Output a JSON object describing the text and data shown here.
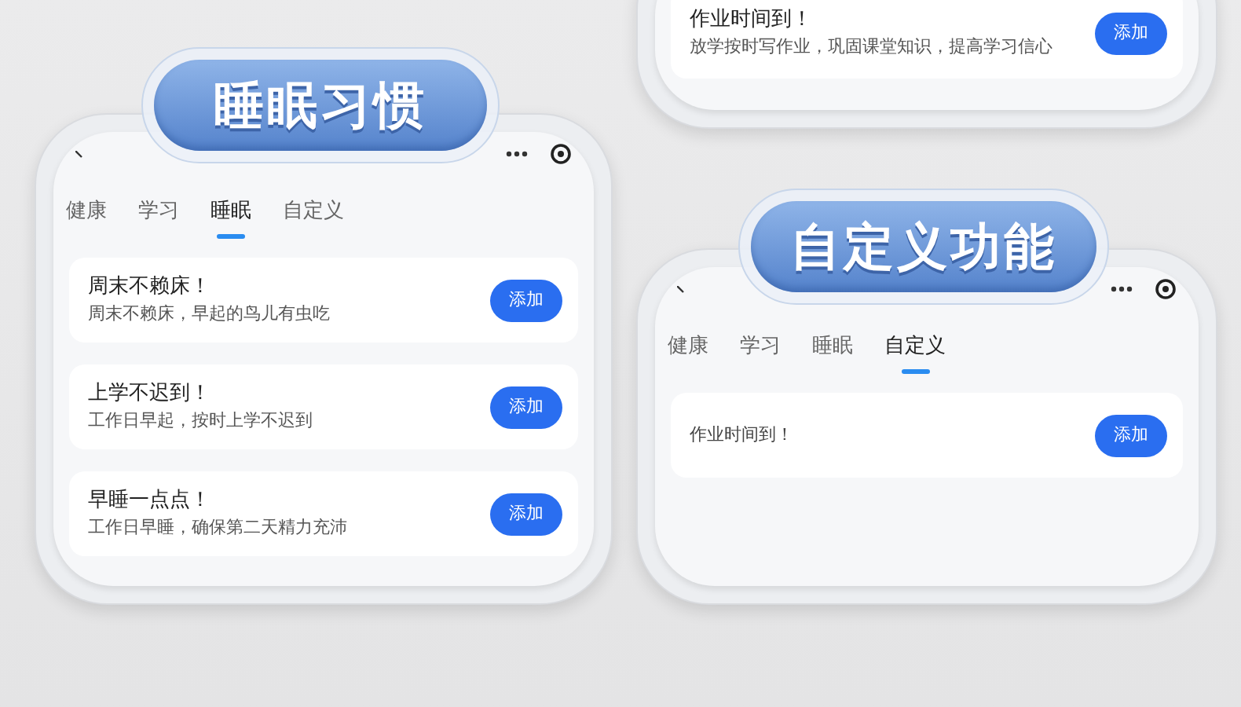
{
  "homework_screen": {
    "cards": [
      {
        "title": "作业时间到！",
        "subtitle": "放学按时写作业，巩固课堂知识，提高学习信心",
        "button": "添加"
      }
    ]
  },
  "sleep_screen": {
    "badge": "睡眠习惯",
    "tabs": [
      {
        "label": "健康",
        "selected": false
      },
      {
        "label": "学习",
        "selected": false
      },
      {
        "label": "睡眠",
        "selected": true
      },
      {
        "label": "自定义",
        "selected": false
      }
    ],
    "cards": [
      {
        "title": "周末不赖床！",
        "subtitle": "周末不赖床，早起的鸟儿有虫吃",
        "button": "添加"
      },
      {
        "title": "上学不迟到！",
        "subtitle": "工作日早起，按时上学不迟到",
        "button": "添加"
      },
      {
        "title": "早睡一点点！",
        "subtitle": "工作日早睡，确保第二天精力充沛",
        "button": "添加"
      }
    ]
  },
  "custom_screen": {
    "badge": "自定义功能",
    "tabs": [
      {
        "label": "健康",
        "selected": false
      },
      {
        "label": "学习",
        "selected": false
      },
      {
        "label": "睡眠",
        "selected": false
      },
      {
        "label": "自定义",
        "selected": true
      }
    ],
    "cards": [
      {
        "title": "作业时间到！",
        "button": "添加"
      }
    ]
  }
}
